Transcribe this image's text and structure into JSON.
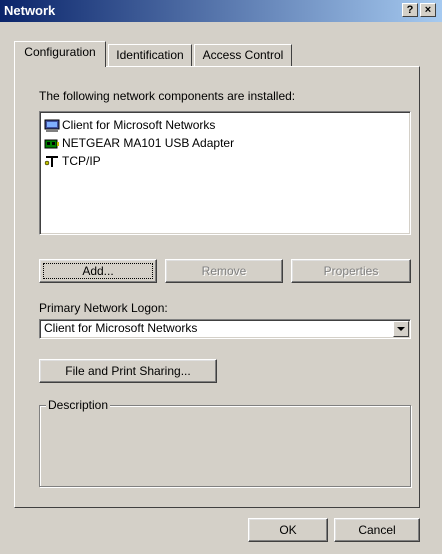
{
  "window": {
    "title": "Network",
    "help_label": "?",
    "close_label": "×"
  },
  "tabs": [
    {
      "label": "Configuration"
    },
    {
      "label": "Identification"
    },
    {
      "label": "Access Control"
    }
  ],
  "config": {
    "installed_label": "The following network components are installed:",
    "components": [
      {
        "label": "Client for Microsoft Networks",
        "icon": "client-network-icon"
      },
      {
        "label": "NETGEAR MA101 USB Adapter",
        "icon": "network-adapter-icon"
      },
      {
        "label": "TCP/IP",
        "icon": "protocol-icon"
      }
    ],
    "add_label": "Add...",
    "remove_label": "Remove",
    "properties_label": "Properties",
    "primary_logon_label": "Primary Network Logon:",
    "primary_logon_value": "Client for Microsoft Networks",
    "file_print_label": "File and Print Sharing...",
    "description_label": "Description"
  },
  "footer": {
    "ok_label": "OK",
    "cancel_label": "Cancel"
  }
}
